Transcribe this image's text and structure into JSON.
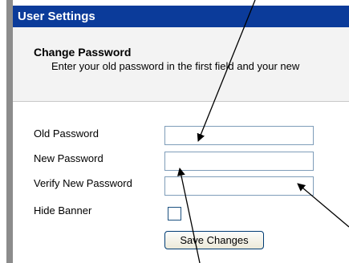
{
  "window": {
    "title": "User Settings"
  },
  "change_password": {
    "heading": "Change Password",
    "description": "Enter your old password in the first field and your new"
  },
  "form": {
    "old_password_label": "Old Password",
    "old_password_value": "",
    "new_password_label": "New Password",
    "new_password_value": "",
    "verify_password_label": "Verify New Password",
    "verify_password_value": "",
    "hide_banner_label": "Hide Banner",
    "hide_banner_checked": false,
    "save_button_label": "Save Changes"
  },
  "colors": {
    "titlebar": "#0b3b9a",
    "panel_bg": "#f3f3f3",
    "input_border": "#7f9db9"
  }
}
